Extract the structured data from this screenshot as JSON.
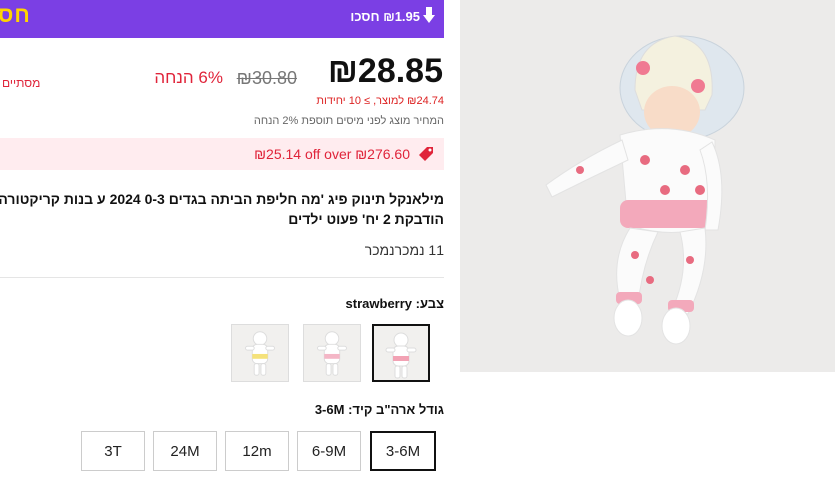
{
  "banner": {
    "left_mark": "חס",
    "save_text": "₪1.95 חסכו"
  },
  "price": {
    "current": "₪28.85",
    "original": "₪30.80",
    "discount": "6% הנחה",
    "side_label": "מסתיים",
    "per_unit": "₪24.74 למוצר, ≥ 10 יחידות",
    "tax_note": "המחיר מוצג לפני מיסים תוספת 2% הנחה"
  },
  "coupon": {
    "text": "₪25.14 off over ₪276.60"
  },
  "product": {
    "title_line1": "מילאנקל תינוק פיג 'מה חליפת הביתה בגדים 0-3 2024 ע בנות קריקטורה",
    "title_line2": "הודבקת 2 יח' פעוט ילדים",
    "sold": "11 נמכרנמכר"
  },
  "color": {
    "label": "צבע: strawberry"
  },
  "size": {
    "label": "גודל ארה\"ב קיד: 3-6M",
    "options": [
      "3-6M",
      "6-9M",
      "12m",
      "24M",
      "3T"
    ]
  },
  "colors": {
    "brand_purple": "#7b3fe4",
    "accent_red": "#e0243a",
    "coupon_bg": "#ffecef"
  }
}
